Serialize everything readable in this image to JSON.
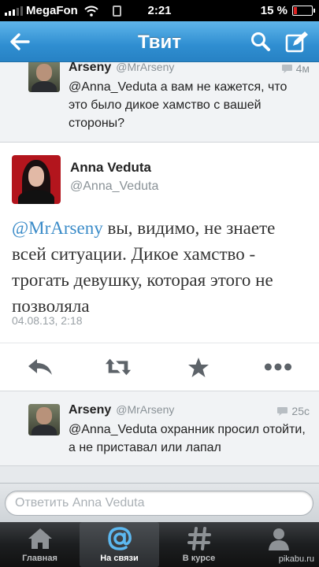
{
  "status_bar": {
    "carrier": "MegaFon",
    "time": "2:21",
    "battery_percent": "15 %",
    "signal_bars": 3
  },
  "nav": {
    "title": "Твит",
    "icons": [
      "back-arrow-icon",
      "search-icon",
      "compose-icon"
    ]
  },
  "tweets": {
    "previous": {
      "name": "Arseny",
      "handle": "@MrArseny",
      "text": "@Anna_Veduta а вам не кажется, что это было дикое хамство с вашей стороны?",
      "time": "4м"
    },
    "main": {
      "name": "Anna Veduta",
      "handle": "@Anna_Veduta",
      "mention": "@MrArseny",
      "text": " вы, видимо, не знаете всей ситуации. Дикое хамство - трогать девушку, которая этого не позволяла",
      "date": "04.08.13, 2:18",
      "actions": [
        "reply-icon",
        "retweet-icon",
        "favorite-icon",
        "more-icon"
      ]
    },
    "reply": {
      "name": "Arseny",
      "handle": "@MrArseny",
      "text": "@Anna_Veduta охранник просил отойти, а не приставал или лапал",
      "time": "25с"
    }
  },
  "reply_bar": {
    "placeholder": "Ответить Anna Veduta"
  },
  "tabs": [
    {
      "label": "Главная",
      "icon": "home-icon",
      "active": false
    },
    {
      "label": "На связи",
      "icon": "at-icon",
      "active": true
    },
    {
      "label": "В курсе",
      "icon": "hashtag-icon",
      "active": false
    },
    {
      "label": "",
      "icon": "profile-icon",
      "active": false
    }
  ],
  "watermark": "pikabu.ru",
  "colors": {
    "navbar": "#2f8ed1",
    "mention": "#3a8bc8",
    "tabbar": "#1c1e20"
  }
}
